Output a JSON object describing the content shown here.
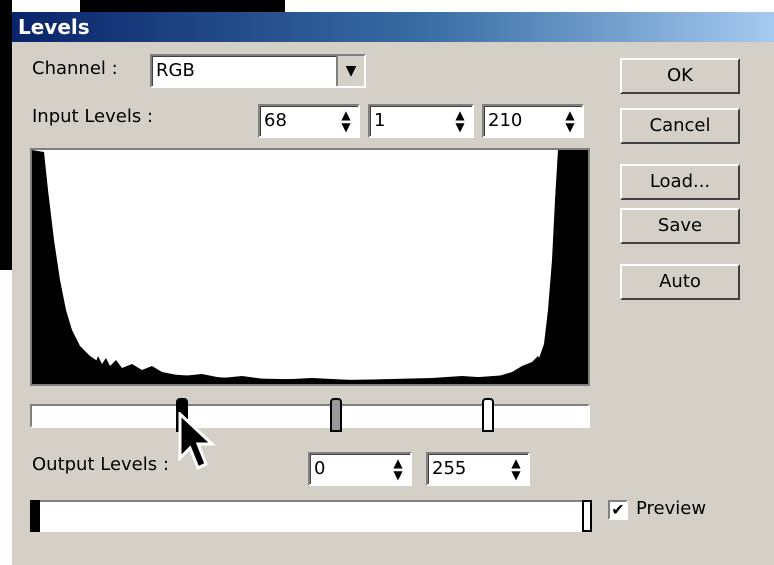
{
  "window": {
    "title": "Levels"
  },
  "channel": {
    "label": "Channel :",
    "value": "RGB"
  },
  "input_levels": {
    "label": "Input Levels :",
    "black": "68",
    "gamma": "1",
    "white": "210"
  },
  "output_levels": {
    "label": "Output Levels :",
    "black": "0",
    "white": "255"
  },
  "buttons": {
    "ok": "OK",
    "cancel": "Cancel",
    "load": "Load...",
    "save": "Save",
    "auto": "Auto"
  },
  "preview": {
    "label": "Preview",
    "checked": true,
    "mark": "✔"
  },
  "icons": {
    "combo_arrow": "▼",
    "spin_up": "▲",
    "spin_down": "▼"
  }
}
